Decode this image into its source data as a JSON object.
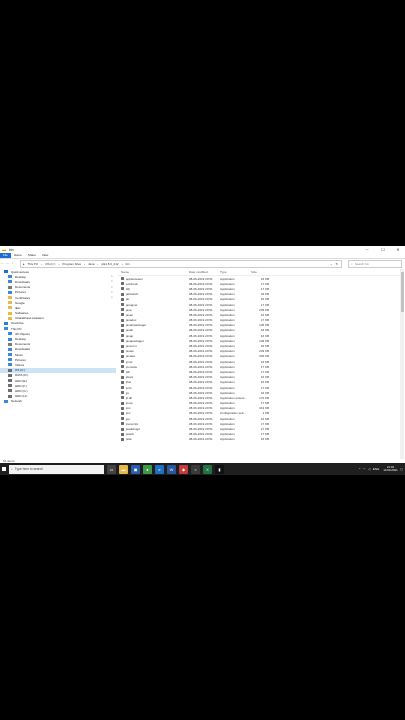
{
  "window": {
    "title": "bin",
    "minimize_glyph": "─",
    "maximize_glyph": "☐",
    "close_glyph": "✕"
  },
  "ribbon": {
    "tabs": [
      "File",
      "Home",
      "Share",
      "View"
    ]
  },
  "address": {
    "segments": [
      "This PC",
      "OS (C:)",
      "Program Files",
      "Java",
      "jdk1.8.0_212",
      "bin"
    ],
    "search_placeholder": "Search bin"
  },
  "nav": {
    "items": [
      {
        "label": "Quick access",
        "icon": "star-icon",
        "color": "#1a6fd1",
        "pinned": false
      },
      {
        "label": "Desktop",
        "icon": "desktop-icon",
        "color": "#3b88d8",
        "pinned": true
      },
      {
        "label": "Downloads",
        "icon": "download-icon",
        "color": "#3b88d8",
        "pinned": true
      },
      {
        "label": "Documents",
        "icon": "documents-icon",
        "color": "#7a7a7a",
        "pinned": true
      },
      {
        "label": "Pictures",
        "icon": "pictures-icon",
        "color": "#3b88d8",
        "pinned": true
      },
      {
        "label": "Certificates",
        "icon": "folder-icon",
        "color": "#e8b84a",
        "pinned": true
      },
      {
        "label": "Google",
        "icon": "folder-icon",
        "color": "#e8b84a",
        "pinned": false
      },
      {
        "label": "IELI",
        "icon": "folder-icon",
        "color": "#e8b84a",
        "pinned": false
      },
      {
        "label": "Softwares",
        "icon": "folder-icon",
        "color": "#e8b84a",
        "pinned": false
      },
      {
        "label": "Uttarakhand Academi",
        "icon": "folder-icon",
        "color": "#e8b84a",
        "pinned": false
      },
      {
        "label": "OneDrive",
        "icon": "cloud-icon",
        "color": "#2a7fd4",
        "pinned": false
      },
      {
        "label": "This PC",
        "icon": "computer-icon",
        "color": "#3b88d8",
        "pinned": false
      },
      {
        "label": "3D Objects",
        "icon": "cube-icon",
        "color": "#3b88d8",
        "pinned": false
      },
      {
        "label": "Desktop",
        "icon": "desktop-icon",
        "color": "#3b88d8",
        "pinned": false
      },
      {
        "label": "Documents",
        "icon": "documents-icon",
        "color": "#7a7a7a",
        "pinned": false
      },
      {
        "label": "Downloads",
        "icon": "download-icon",
        "color": "#3b88d8",
        "pinned": false
      },
      {
        "label": "Music",
        "icon": "music-icon",
        "color": "#3b88d8",
        "pinned": false
      },
      {
        "label": "Pictures",
        "icon": "pictures-icon",
        "color": "#3b88d8",
        "pinned": false
      },
      {
        "label": "Videos",
        "icon": "video-icon",
        "color": "#3b88d8",
        "pinned": false
      },
      {
        "label": "OS (C:)",
        "icon": "drive-icon",
        "color": "#6f6f6f",
        "pinned": false,
        "selected": true
      },
      {
        "label": "DATA (D:)",
        "icon": "drive-icon",
        "color": "#6f6f6f",
        "pinned": false
      },
      {
        "label": "HDD (E:)",
        "icon": "drive-icon",
        "color": "#6f6f6f",
        "pinned": false
      },
      {
        "label": "HDD (F:)",
        "icon": "drive-icon",
        "color": "#6f6f6f",
        "pinned": false
      },
      {
        "label": "HDD (G:)",
        "icon": "drive-icon",
        "color": "#6f6f6f",
        "pinned": false
      },
      {
        "label": "HDD (H:)",
        "icon": "drive-icon",
        "color": "#6f6f6f",
        "pinned": false
      },
      {
        "label": "Network",
        "icon": "network-icon",
        "color": "#3b88d8",
        "pinned": false
      }
    ]
  },
  "columns": {
    "name": "Name",
    "date": "Date modified",
    "type": "Type",
    "size": "Size"
  },
  "files": [
    {
      "name": "appletviewer",
      "date": "08-06-2019 20:51",
      "type": "Application",
      "size": "16 KB"
    },
    {
      "name": "extcheck",
      "date": "08-06-2019 20:51",
      "type": "Application",
      "size": "17 KB"
    },
    {
      "name": "idlj",
      "date": "08-06-2019 20:51",
      "type": "Application",
      "size": "17 KB"
    },
    {
      "name": "jabswitch",
      "date": "08-06-2019 20:51",
      "type": "Application",
      "size": "34 KB"
    },
    {
      "name": "jar",
      "date": "08-06-2019 20:51",
      "type": "Application",
      "size": "16 KB"
    },
    {
      "name": "jarsigner",
      "date": "08-06-2019 20:51",
      "type": "Application",
      "size": "17 KB"
    },
    {
      "name": "java",
      "date": "08-06-2019 20:51",
      "type": "Application",
      "size": "203 KB"
    },
    {
      "name": "javac",
      "date": "08-06-2019 20:51",
      "type": "Application",
      "size": "16 KB"
    },
    {
      "name": "javadoc",
      "date": "08-06-2019 20:51",
      "type": "Application",
      "size": "17 KB"
    },
    {
      "name": "javafxpackager",
      "date": "08-06-2019 20:51",
      "type": "Application",
      "size": "145 KB"
    },
    {
      "name": "javah",
      "date": "08-06-2019 20:51",
      "type": "Application",
      "size": "16 KB"
    },
    {
      "name": "javap",
      "date": "08-06-2019 20:51",
      "type": "Application",
      "size": "16 KB"
    },
    {
      "name": "javapackager",
      "date": "08-06-2019 20:51",
      "type": "Application",
      "size": "145 KB"
    },
    {
      "name": "java-rmi",
      "date": "08-06-2019 20:51",
      "type": "Application",
      "size": "16 KB"
    },
    {
      "name": "javaw",
      "date": "08-06-2019 20:51",
      "type": "Application",
      "size": "203 KB"
    },
    {
      "name": "javaws",
      "date": "08-06-2019 20:51",
      "type": "Application",
      "size": "346 KB"
    },
    {
      "name": "jcmd",
      "date": "08-06-2019 20:51",
      "type": "Application",
      "size": "16 KB"
    },
    {
      "name": "jconsole",
      "date": "08-06-2019 20:51",
      "type": "Application",
      "size": "17 KB"
    },
    {
      "name": "jdb",
      "date": "08-06-2019 20:51",
      "type": "Application",
      "size": "17 KB"
    },
    {
      "name": "jdeps",
      "date": "08-06-2019 20:51",
      "type": "Application",
      "size": "16 KB"
    },
    {
      "name": "jhat",
      "date": "08-06-2019 20:51",
      "type": "Application",
      "size": "16 KB"
    },
    {
      "name": "jinfo",
      "date": "08-06-2019 20:51",
      "type": "Application",
      "size": "17 KB"
    },
    {
      "name": "jjs",
      "date": "08-06-2019 20:51",
      "type": "Application",
      "size": "16 KB"
    },
    {
      "name": "jli.dll",
      "date": "08-06-2019 20:51",
      "type": "Application extens...",
      "size": "172 KB"
    },
    {
      "name": "jmap",
      "date": "08-06-2019 20:51",
      "type": "Application",
      "size": "17 KB"
    },
    {
      "name": "jmc",
      "date": "08-06-2019 20:51",
      "type": "Application",
      "size": "313 KB"
    },
    {
      "name": "jmc",
      "date": "08-06-2019 20:51",
      "type": "Configuration sett...",
      "size": "1 KB"
    },
    {
      "name": "jps",
      "date": "08-06-2019 20:51",
      "type": "Application",
      "size": "16 KB"
    },
    {
      "name": "jrunscript",
      "date": "08-06-2019 20:51",
      "type": "Application",
      "size": "17 KB"
    },
    {
      "name": "jsadebugd",
      "date": "08-06-2019 20:51",
      "type": "Application",
      "size": "17 KB"
    },
    {
      "name": "jstack",
      "date": "08-06-2019 20:51",
      "type": "Application",
      "size": "17 KB"
    },
    {
      "name": "jstat",
      "date": "08-06-2019 20:51",
      "type": "Application",
      "size": "16 KB"
    }
  ],
  "status": {
    "text": "54 items"
  },
  "taskbar": {
    "search_placeholder": "Type here to search",
    "apps": [
      {
        "icon": "task-view-icon",
        "color": "#444444",
        "glyph": "▭"
      },
      {
        "icon": "file-explorer-icon",
        "color": "#e8b84a",
        "glyph": "▬"
      },
      {
        "icon": "store-icon",
        "color": "#2a5fb0",
        "glyph": "◼"
      },
      {
        "icon": "chrome-icon",
        "color": "#3c9a4a",
        "glyph": "●"
      },
      {
        "icon": "edge-icon",
        "color": "#1f6fc4",
        "glyph": "e"
      },
      {
        "icon": "word-icon",
        "color": "#2b579a",
        "glyph": "W"
      },
      {
        "icon": "app-icon",
        "color": "#c43b3b",
        "glyph": "◆"
      },
      {
        "icon": "terminal-icon",
        "color": "#3a3a3a",
        "glyph": ">"
      },
      {
        "icon": "excel-icon",
        "color": "#217346",
        "glyph": "X"
      },
      {
        "icon": "command-prompt-icon",
        "color": "#111111",
        "glyph": "▮"
      }
    ],
    "tray": {
      "chevron": "^",
      "wifi": "◠",
      "volume": "◁",
      "lang": "ENG",
      "time": "21:02",
      "date": "10-09-2021"
    }
  }
}
